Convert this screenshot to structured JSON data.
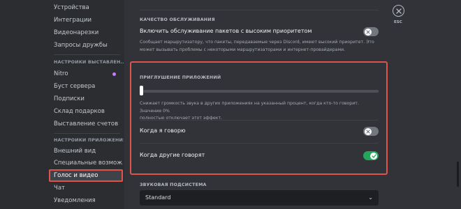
{
  "sidebar": {
    "items_top": [
      "Устройства",
      "Интеграции",
      "Видеонарезки",
      "Запросы дружбы"
    ],
    "section_app_settings": "НАСТРОЙКИ ВЫСТАВЛЕН...",
    "items_billing": [
      "Nitro",
      "Буст сервера",
      "Подписки",
      "Склад подарков",
      "Выставление счетов"
    ],
    "section_app": "НАСТРОЙКИ ПРИЛОЖЕНИЯ",
    "items_app": [
      "Внешний вид",
      "Специальные возмож...",
      "Голос и видео",
      "Чат",
      "Уведомления"
    ],
    "selected_item": "Голос и видео",
    "nitro_dot_color": "#c77dff"
  },
  "qos": {
    "title": "КАЧЕСТВО ОБСЛУЖИВАНИЯ",
    "label": "Включить обслуживание пакетов с высоким приоритетом",
    "description_line1": "Сообщает маршрутизатору, что пакеты, передаваемые через Discord, имеют высокий приоритет. Это",
    "description_line2": "может вызывать проблемы с некоторыми маршрутизаторами и интернет-провайдерами.",
    "enabled": false
  },
  "attenuation": {
    "title": "ПРИГЛУШЕНИЕ ПРИЛОЖЕНИЙ",
    "slider_percent": 0,
    "description_line1": "Снижает громкость звука в других приложениях на указанный процент, когда кто-то говорит. Значение 0%",
    "description_line2": "полностью отключает этот эффект.",
    "when_i_speak_label": "Когда я говорю",
    "when_i_speak_enabled": false,
    "when_others_speak_label": "Когда другие говорят",
    "when_others_speak_enabled": true
  },
  "subsystem": {
    "title": "ЗВУКОВАЯ ПОДСИСТЕМА",
    "value": "Standard"
  },
  "esc": {
    "label": "ESC"
  },
  "colors": {
    "accent_green": "#23a55a",
    "highlight_red": "#e0534b"
  }
}
